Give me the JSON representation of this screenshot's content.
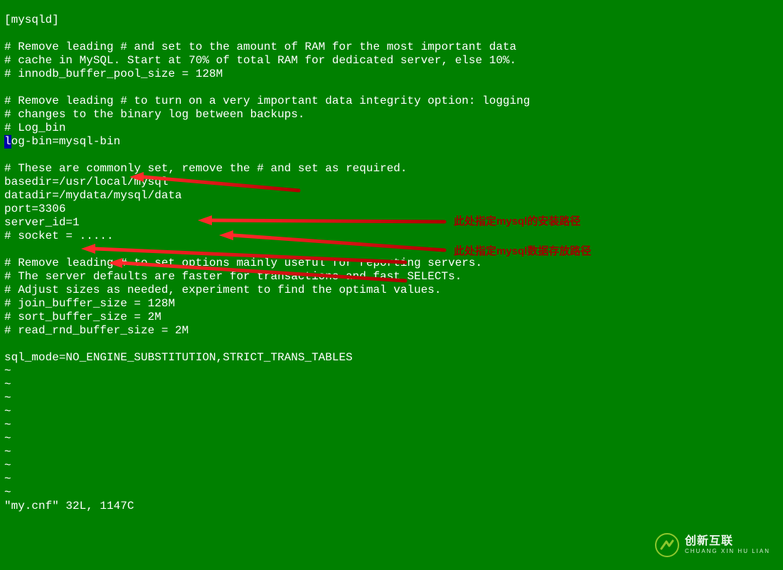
{
  "lines": [
    "",
    "[mysqld]",
    "",
    "# Remove leading # and set to the amount of RAM for the most important data",
    "# cache in MySQL. Start at 70% of total RAM for dedicated server, else 10%.",
    "# innodb_buffer_pool_size = 128M",
    "",
    "# Remove leading # to turn on a very important data integrity option: logging",
    "# changes to the binary log between backups.",
    "# Log_bin",
    "",
    "",
    "# These are commonly set, remove the # and set as required.",
    "basedir=/usr/local/mysql",
    "datadir=/mydata/mysql/data",
    "port=3306",
    "server_id=1",
    "# socket = .....",
    "",
    "# Remove leading # to set options mainly useful for reporting servers.",
    "# The server defaults are faster for transactions and fast SELECTs.",
    "# Adjust sizes as needed, experiment to find the optimal values.",
    "# join_buffer_size = 128M",
    "# sort_buffer_size = 2M",
    "# read_rnd_buffer_size = 2M",
    "",
    "sql_mode=NO_ENGINE_SUBSTITUTION,STRICT_TRANS_TABLES",
    "~",
    "~",
    "~",
    "~",
    "~",
    "~",
    "~",
    "~",
    "~",
    "~"
  ],
  "cursor_line": {
    "cursor_char": "l",
    "rest": "og-bin=mysql-bin"
  },
  "status_line": "\"my.cnf\" 32L, 1147C",
  "annotations": {
    "install_path": "此处指定mysql的安装路径",
    "data_path": "此处指定mysql数据存放路径"
  },
  "logo": {
    "cn": "创新互联",
    "en": "CHUANG XIN HU LIAN"
  }
}
